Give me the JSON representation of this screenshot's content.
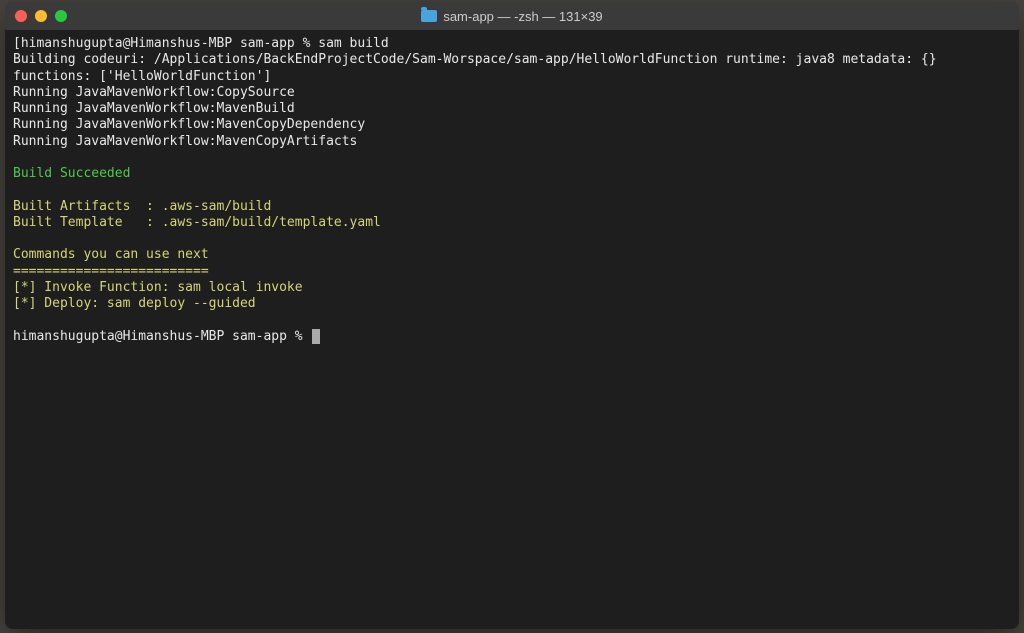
{
  "window": {
    "title": "sam-app — -zsh — 131×39"
  },
  "terminal": {
    "prompt1": "himanshugupta@Himanshus-MBP sam-app % ",
    "command1": "sam build",
    "line_build_codeuri": "Building codeuri: /Applications/BackEndProjectCode/Sam-Worspace/sam-app/HelloWorldFunction runtime: java8 metadata: {} functions: ['HelloWorldFunction']",
    "line_run1": "Running JavaMavenWorkflow:CopySource",
    "line_run2": "Running JavaMavenWorkflow:MavenBuild",
    "line_run3": "Running JavaMavenWorkflow:MavenCopyDependency",
    "line_run4": "Running JavaMavenWorkflow:MavenCopyArtifacts",
    "success": "Build Succeeded",
    "artifacts": "Built Artifacts  : .aws-sam/build",
    "template": "Built Template   : .aws-sam/build/template.yaml",
    "commands_header": "Commands you can use next",
    "commands_divider": "=========================",
    "cmd_invoke": "[*] Invoke Function: sam local invoke",
    "cmd_deploy": "[*] Deploy: sam deploy --guided",
    "prompt2": "himanshugupta@Himanshus-MBP sam-app % "
  }
}
